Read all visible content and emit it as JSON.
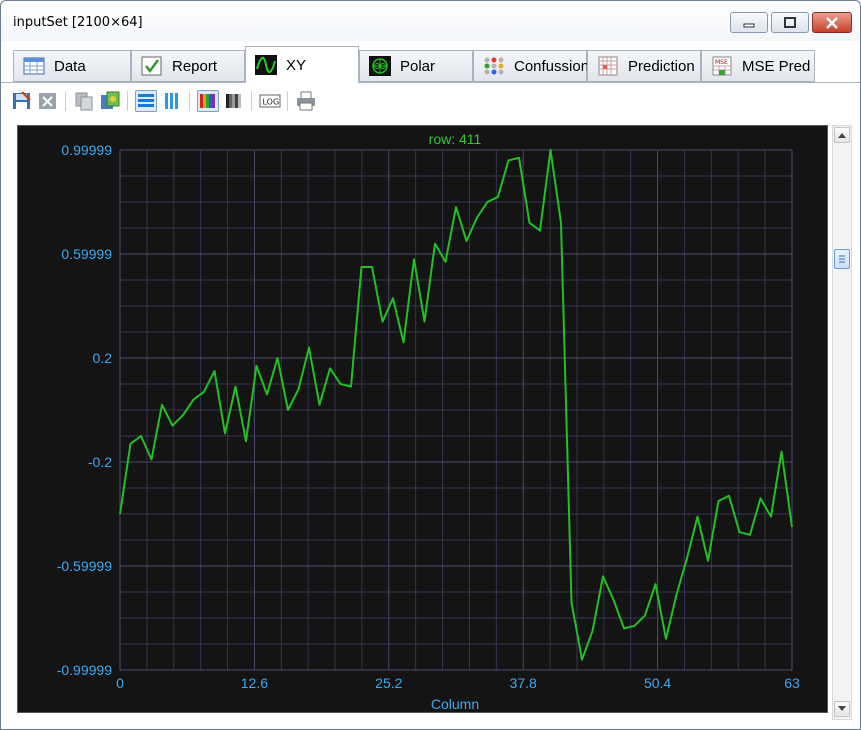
{
  "window": {
    "title": "inputSet [2100×64]",
    "buttons": {
      "minimize": "minimize-icon",
      "maximize": "maximize-icon",
      "close": "close-icon"
    }
  },
  "tabs": [
    {
      "label": "Data",
      "icon": "table-icon"
    },
    {
      "label": "Report",
      "icon": "checkmark-icon"
    },
    {
      "label": "XY",
      "icon": "waveform-icon",
      "active": true
    },
    {
      "label": "Polar",
      "icon": "polar-icon"
    },
    {
      "label": "Confussion",
      "icon": "dot-matrix-icon"
    },
    {
      "label": "Prediction",
      "icon": "grid-chart-icon"
    },
    {
      "label": "MSE Pred",
      "icon": "mse-icon"
    }
  ],
  "toolbar": {
    "items": [
      "save-image-icon",
      "delete-icon",
      "copy-icon",
      "paste-image-icon",
      "rows-view-icon",
      "columns-view-icon",
      "color-palette-icon",
      "grayscale-palette-icon",
      "log-scale-icon",
      "print-icon"
    ],
    "log_label": "LOG"
  },
  "chart_data": {
    "type": "line",
    "title": "row: 411",
    "xlabel": "Column",
    "ylabel": "",
    "xlim": [
      0,
      63
    ],
    "ylim": [
      -0.99999,
      0.99999
    ],
    "x_ticks": [
      "0",
      "12.6",
      "25.2",
      "37.8",
      "50.4",
      "63"
    ],
    "y_ticks": [
      "0.99999",
      "0.59999",
      "0.2",
      "-0.2",
      "-0.59999",
      "-0.99999"
    ],
    "grid": true,
    "color": "#22c022",
    "series": [
      {
        "values": [
          -0.4,
          -0.13,
          -0.1,
          -0.19,
          0.02,
          -0.06,
          -0.02,
          0.04,
          0.07,
          0.15,
          -0.09,
          0.09,
          -0.12,
          0.17,
          0.06,
          0.2,
          0.0,
          0.08,
          0.24,
          0.02,
          0.16,
          0.1,
          0.09,
          0.55,
          0.55,
          0.34,
          0.43,
          0.26,
          0.58,
          0.34,
          0.64,
          0.57,
          0.78,
          0.65,
          0.74,
          0.8,
          0.82,
          0.96,
          0.97,
          0.72,
          0.69,
          1.0,
          0.72,
          -0.74,
          -0.96,
          -0.85,
          -0.64,
          -0.73,
          -0.84,
          -0.83,
          -0.79,
          -0.67,
          -0.88,
          -0.71,
          -0.57,
          -0.41,
          -0.58,
          -0.35,
          -0.33,
          -0.47,
          -0.48,
          -0.34,
          -0.41,
          -0.16,
          -0.45
        ]
      }
    ]
  }
}
